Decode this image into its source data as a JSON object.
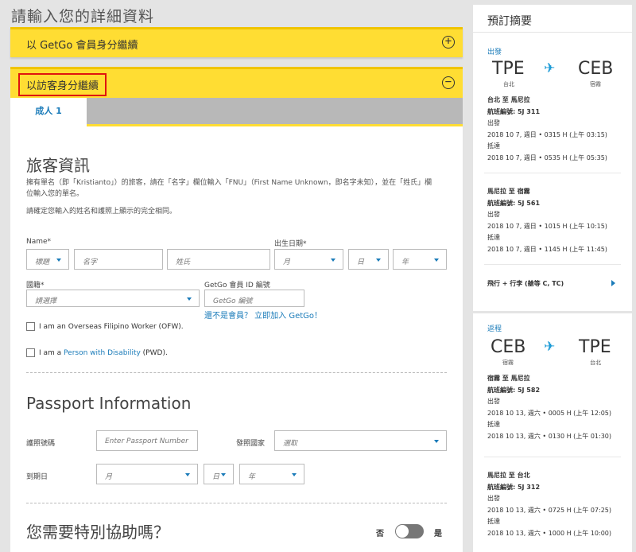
{
  "page_title": "請輸入您的詳細資料",
  "member_section": {
    "label": "以 GetGo 會員身分繼續",
    "toggle": "+"
  },
  "guest_section": {
    "label": "以訪客身分繼續",
    "toggle": "−"
  },
  "tabs": [
    {
      "label": "成人 1",
      "active": true
    }
  ],
  "traveler": {
    "title": "旅客資訊",
    "help_line1": "擁有單名（即「Kristianto」）的旅客，請在「名字」欄位輸入「FNU」（First Name Unknown，即名字未知），並在「姓氏」欄",
    "help_line2": "位輸入您的單名。",
    "help_line3": "請確定您輸入的姓名和護照上顯示的完全相同。",
    "name_label": "Name*",
    "title_placeholder": "標題",
    "first_name_placeholder": "名字",
    "last_name_placeholder": "姓氏",
    "dob_label": "出生日期*",
    "month_placeholder": "月",
    "day_placeholder": "日",
    "year_placeholder": "年",
    "nationality_label": "國籍*",
    "nationality_placeholder": "請選擇",
    "getgo_id_label": "GetGo 會員 ID 編號",
    "getgo_id_placeholder": "GetGo 編號",
    "join_link": "還不是會員？ 立即加入 GetGo！",
    "ofw_label": "I am an Overseas Filipino Worker (OFW).",
    "pwd_prefix": "I am a ",
    "pwd_link": "Person with Disability",
    "pwd_suffix": " (PWD)."
  },
  "passport": {
    "title": "Passport Information",
    "number_label": "護照號碼",
    "number_placeholder": "Enter Passport Number",
    "country_label": "發照國家",
    "country_placeholder": "選取",
    "expiry_label": "到期日",
    "month_placeholder": "月",
    "day_placeholder": "日",
    "year_placeholder": "年"
  },
  "assistance": {
    "title": "您需要特別協助嗎？",
    "no_label": "否",
    "yes_label": "是",
    "enabled": false
  },
  "summary": {
    "title": "預訂摘要",
    "outbound": {
      "label": "出發",
      "from_code": "TPE",
      "from_city": "台北",
      "to_code": "CEB",
      "to_city": "宿霧",
      "segments": [
        {
          "route": "台北 至 馬尼拉",
          "flight": "航班編號: 5J 311",
          "dep_label": "出發",
          "dep_time": "2018 10 7, 週日 • 0315 H (上午 03:15)",
          "arr_label": "抵達",
          "arr_time": "2018 10 7, 週日 • 0535 H (上午 05:35)"
        },
        {
          "route": "馬尼拉 至 宿霧",
          "flight": "航班編號: 5J 561",
          "dep_label": "出發",
          "dep_time": "2018 10 7, 週日 • 1015 H (上午 10:15)",
          "arr_label": "抵達",
          "arr_time": "2018 10 7, 週日 • 1145 H (上午 11:45)"
        }
      ],
      "baggage": "飛行 + 行李 (艙等 C, TC)"
    },
    "inbound": {
      "label": "返程",
      "from_code": "CEB",
      "from_city": "宿霧",
      "to_code": "TPE",
      "to_city": "台北",
      "segments": [
        {
          "route": "宿霧 至 馬尼拉",
          "flight": "航班編號: 5J 582",
          "dep_label": "出發",
          "dep_time": "2018 10 13, 週六 • 0005 H (上午 12:05)",
          "arr_label": "抵達",
          "arr_time": "2018 10 13, 週六 • 0130 H (上午 01:30)"
        },
        {
          "route": "馬尼拉 至 台北",
          "flight": "航班編號: 5J 312",
          "dep_label": "出發",
          "dep_time": "2018 10 13, 週六 • 0725 H (上午 07:25)",
          "arr_label": "抵達",
          "arr_time": "2018 10 13, 週六 • 1000 H (上午 10:00)"
        }
      ]
    }
  },
  "icons": {
    "plane": "airplane-icon",
    "caret": "caret-down-icon",
    "plus": "plus-circle-icon",
    "minus": "minus-circle-icon",
    "arrow": "chevron-right-icon"
  },
  "colors": {
    "accent_yellow": "#ffdd33",
    "link_blue": "#1a7bb9",
    "highlight_red": "#e0140f"
  }
}
